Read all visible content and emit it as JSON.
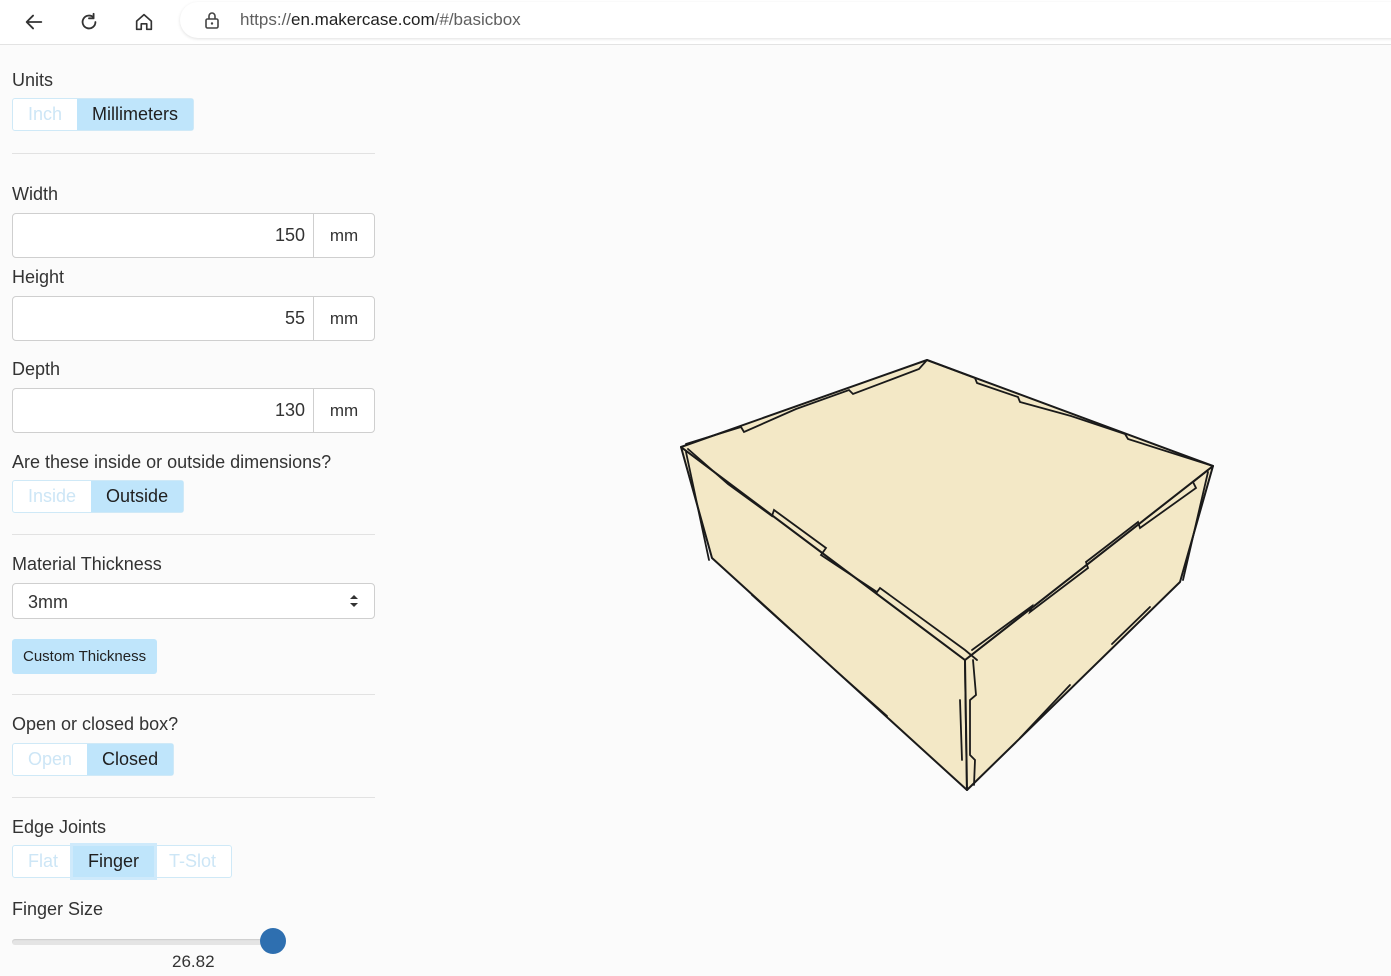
{
  "browser": {
    "url_prefix": "https://",
    "url_host": "en.makercase.com",
    "url_path": "/#/basicbox"
  },
  "units": {
    "label": "Units",
    "options": [
      "Inch",
      "Millimeters"
    ],
    "selected": "Millimeters"
  },
  "dimensions": {
    "width": {
      "label": "Width",
      "value": "150",
      "unit": "mm"
    },
    "height": {
      "label": "Height",
      "value": "55",
      "unit": "mm"
    },
    "depth": {
      "label": "Depth",
      "value": "130",
      "unit": "mm"
    }
  },
  "dimension_type": {
    "label": "Are these inside or outside dimensions?",
    "options": [
      "Inside",
      "Outside"
    ],
    "selected": "Outside"
  },
  "material": {
    "label": "Material Thickness",
    "value": "3mm",
    "custom_button": "Custom Thickness"
  },
  "box_type": {
    "label": "Open or closed box?",
    "options": [
      "Open",
      "Closed"
    ],
    "selected": "Closed"
  },
  "edge_joints": {
    "label": "Edge Joints",
    "options": [
      "Flat",
      "Finger",
      "T-Slot"
    ],
    "selected": "Finger"
  },
  "finger_size": {
    "label": "Finger Size",
    "value": "26.82",
    "slider_fraction": 0.95
  },
  "colors": {
    "accent": "#bfe5fb",
    "thumb": "#2e6fb0",
    "wood": "#f3e8c6"
  }
}
